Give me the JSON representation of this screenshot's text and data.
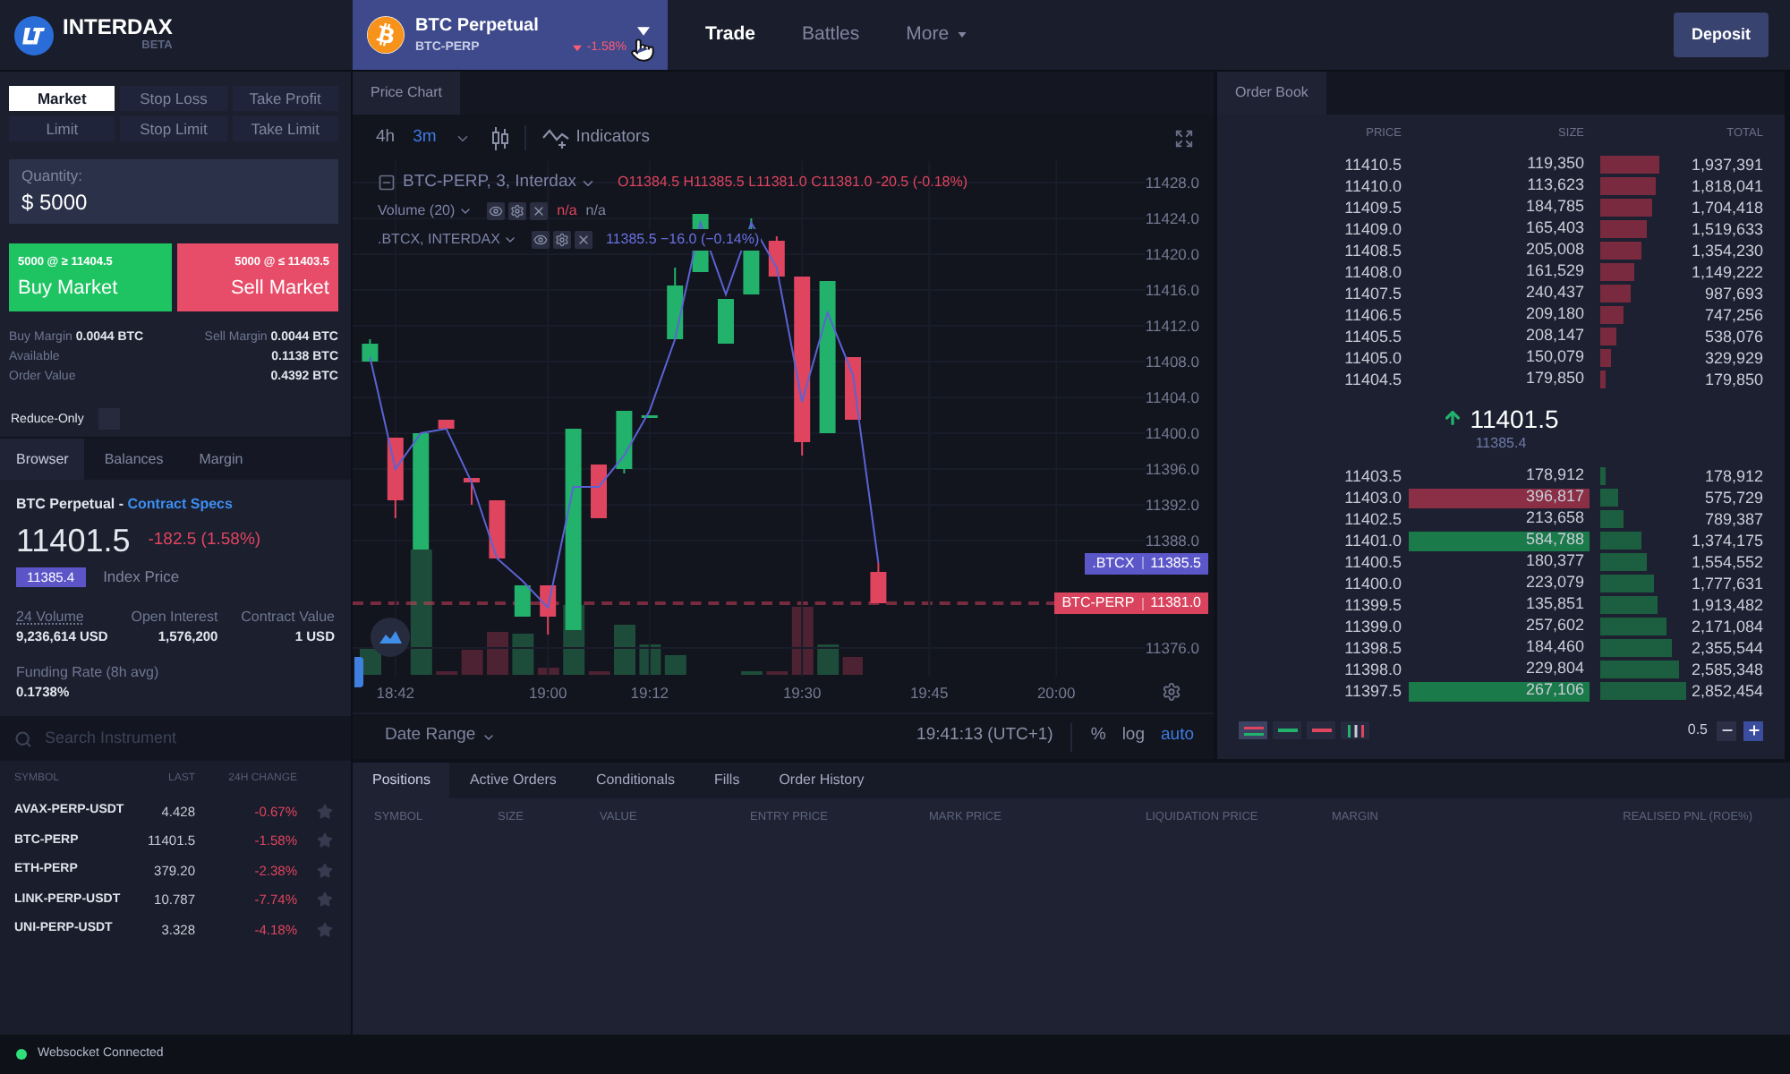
{
  "header": {
    "brand": "INTERDAX",
    "brand_tag": "BETA",
    "instrument": {
      "name": "BTC Perpetual",
      "symbol": "BTC-PERP",
      "change": "-1.58%"
    },
    "nav": [
      {
        "label": "Trade",
        "selected": true,
        "has_menu": false
      },
      {
        "label": "Battles",
        "selected": false,
        "has_menu": false
      },
      {
        "label": "More",
        "selected": false,
        "has_menu": true
      }
    ],
    "deposit_button": "Deposit"
  },
  "order_form": {
    "order_types": [
      {
        "label": "Market",
        "selected": true
      },
      {
        "label": "Stop Loss",
        "selected": false
      },
      {
        "label": "Take Profit",
        "selected": false
      },
      {
        "label": "Limit",
        "selected": false
      },
      {
        "label": "Stop Limit",
        "selected": false
      },
      {
        "label": "Take Limit",
        "selected": false
      }
    ],
    "quantity": {
      "label": "Quantity:",
      "value": "$ 5000"
    },
    "buy_button": {
      "detail": "5000 @ ≥ 11404.5",
      "label": "Buy Market"
    },
    "sell_button": {
      "detail": "5000 @ ≤ 11403.5",
      "label": "Sell Market"
    },
    "margins": [
      {
        "label": "Buy Margin",
        "value": "0.0044 BTC"
      },
      {
        "label": "Sell Margin",
        "value": "0.0044 BTC"
      }
    ],
    "balances": [
      {
        "label": "Available",
        "value": "0.1138 BTC"
      },
      {
        "label": "Order Value",
        "value": "0.4392 BTC"
      }
    ],
    "reduce_only": {
      "label": "Reduce-Only",
      "checked": false
    }
  },
  "info_panel": {
    "tabs": [
      {
        "label": "Browser",
        "selected": true
      },
      {
        "label": "Balances",
        "selected": false
      },
      {
        "label": "Margin",
        "selected": false
      }
    ],
    "title": "BTC Perpetual -",
    "link": "Contract Specs",
    "last_price": "11401.5",
    "change": "-182.5 (1.58%)",
    "index_price": "11385.4",
    "index_label": "Index Price",
    "stats": [
      {
        "label": "24 Volume",
        "value": "9,236,614 USD",
        "has_hint": true
      },
      {
        "label": "Open Interest",
        "value": "1,576,200",
        "has_hint": false
      },
      {
        "label": "Contract Value",
        "value": "1 USD",
        "has_hint": false
      }
    ],
    "funding": {
      "label": "Funding Rate (8h avg)",
      "value": "0.1738%"
    }
  },
  "instrument_list": {
    "search": {
      "placeholder": "Search Instrument"
    },
    "columns": [
      "SYMBOL",
      "LAST",
      "24H CHANGE"
    ],
    "rows": [
      {
        "symbol": "AVAX-PERP-USDT",
        "last": "4.428",
        "change": "-0.67%",
        "starred": false
      },
      {
        "symbol": "BTC-PERP",
        "last": "11401.5",
        "change": "-1.58%",
        "starred": false
      },
      {
        "symbol": "ETH-PERP",
        "last": "379.20",
        "change": "-2.38%",
        "starred": false
      },
      {
        "symbol": "LINK-PERP-USDT",
        "last": "10.787",
        "change": "-7.74%",
        "starred": false
      },
      {
        "symbol": "UNI-PERP-USDT",
        "last": "3.328",
        "change": "-4.18%",
        "starred": false
      }
    ]
  },
  "chart_panel": {
    "tab": "Price Chart",
    "intervals": [
      {
        "label": "4h",
        "selected": false
      },
      {
        "label": "3m",
        "selected": true
      }
    ],
    "indicators_button": "Indicators",
    "legend": {
      "title": "BTC-PERP, 3, Interdax",
      "ohlc": "O11384.5 H11385.5 L11381.0 C11381.0 -20.5 (-0.18%)",
      "volume": {
        "label": "Volume (20)",
        "values": [
          {
            "text": "n/a",
            "color": "#e0455f"
          },
          {
            "text": "n/a",
            "color": "#7f869f"
          }
        ]
      },
      "compare": {
        "label": ".BTCX, INTERDAX",
        "value": "11385.5 −16.0 (−0.14%)"
      }
    },
    "chart_data": {
      "type": "line",
      "categories": [
        null,
        "18:42",
        null,
        null,
        null,
        null,
        null,
        "19:00",
        null,
        null,
        null,
        "19:12",
        null,
        null,
        null,
        null,
        null,
        "19:30",
        null,
        null,
        null,
        null,
        "19:45",
        null,
        null,
        null,
        null,
        "20:00",
        null,
        null,
        null
      ],
      "series": [
        {
          "name": ".BTCX",
          "color": "#5b63d3",
          "values": [
            11408.5,
            11396,
            11400,
            11400.5,
            11394.5,
            11386,
            11383.5,
            11380.5,
            11394,
            11394,
            11397.5,
            11402.5,
            11410.5,
            11423.5,
            11415.5,
            11423.5,
            11418.5,
            11403.5,
            11413.5,
            11406.5,
            11385.5,
            null,
            null,
            null,
            null,
            null,
            null,
            null,
            null,
            null,
            null
          ]
        }
      ],
      "ylim": [
        11372.8,
        11430.4
      ],
      "yticks": [
        {
          "value": 11428,
          "label": "11428.0"
        },
        {
          "value": 11424,
          "label": "11424.0"
        },
        {
          "value": 11420,
          "label": "11420.0"
        },
        {
          "value": 11416,
          "label": "11416.0"
        },
        {
          "value": 11412,
          "label": "11412.0"
        },
        {
          "value": 11408,
          "label": "11408.0"
        },
        {
          "value": 11404,
          "label": "11404.0"
        },
        {
          "value": 11400,
          "label": "11400.0"
        },
        {
          "value": 11396,
          "label": "11396.0"
        },
        {
          "value": 11392,
          "label": "11392.0"
        },
        {
          "value": 11388,
          "label": "11388.0"
        },
        {
          "value": 11376,
          "label": "11376.0"
        }
      ],
      "grid": true
    },
    "price_tags": [
      {
        "value": "11385.5",
        "color": "#5b57c9",
        "line": false
      },
      {
        "symbol": "BTC-PERP",
        "value": "11381.0",
        "color": "#d9435e",
        "line": true
      }
    ],
    "footer": {
      "date_range": "Date Range",
      "time": "19:41:13 (UTC+1)",
      "scale_options": [
        {
          "label": "%",
          "selected": false
        },
        {
          "label": "log",
          "selected": false
        },
        {
          "label": "auto",
          "selected": true
        }
      ]
    }
  },
  "order_book": {
    "tab": "Order Book",
    "columns": [
      "PRICE",
      "SIZE",
      "TOTAL"
    ],
    "asks": [
      {
        "price": "11410.5",
        "size": "119,350",
        "total": "1,937,391"
      },
      {
        "price": "11410.0",
        "size": "113,623",
        "total": "1,818,041"
      },
      {
        "price": "11409.5",
        "size": "184,785",
        "total": "1,704,418"
      },
      {
        "price": "11409.0",
        "size": "165,403",
        "total": "1,519,633"
      },
      {
        "price": "11408.5",
        "size": "205,008",
        "total": "1,354,230"
      },
      {
        "price": "11408.0",
        "size": "161,529",
        "total": "1,149,222"
      },
      {
        "price": "11407.5",
        "size": "240,437",
        "total": "987,693"
      },
      {
        "price": "11406.5",
        "size": "209,180",
        "total": "747,256"
      },
      {
        "price": "11405.5",
        "size": "208,147",
        "total": "538,076"
      },
      {
        "price": "11405.0",
        "size": "150,079",
        "total": "329,929"
      },
      {
        "price": "11404.5",
        "size": "179,850",
        "total": "179,850"
      }
    ],
    "last_price": {
      "value": "11401.5",
      "rising": true
    },
    "index_price": "11385.4",
    "bids": [
      {
        "price": "11403.5",
        "size": "178,912",
        "total": "178,912",
        "flash": false
      },
      {
        "price": "11403.0",
        "size": "396,817",
        "total": "575,729",
        "flash": true,
        "color": "#8a2f45"
      },
      {
        "price": "11402.5",
        "size": "213,658",
        "total": "789,387",
        "flash": false
      },
      {
        "price": "11401.0",
        "size": "584,788",
        "total": "1,374,175",
        "flash": true,
        "color": "#1a7a4a"
      },
      {
        "price": "11400.5",
        "size": "180,377",
        "total": "1,554,552",
        "flash": false
      },
      {
        "price": "11400.0",
        "size": "223,079",
        "total": "1,777,631",
        "flash": false
      },
      {
        "price": "11399.5",
        "size": "135,851",
        "total": "1,913,482",
        "flash": false
      },
      {
        "price": "11399.0",
        "size": "257,602",
        "total": "2,171,084",
        "flash": false
      },
      {
        "price": "11398.5",
        "size": "184,460",
        "total": "2,355,544",
        "flash": false
      },
      {
        "price": "11398.0",
        "size": "229,804",
        "total": "2,585,348",
        "flash": false
      },
      {
        "price": "11397.5",
        "size": "267,106",
        "total": "2,852,454",
        "flash": true,
        "color": "#1a7a4a"
      }
    ],
    "views": [
      {
        "kind": "both",
        "selected": true
      },
      {
        "kind": "bids",
        "selected": false
      },
      {
        "kind": "asks",
        "selected": false
      },
      {
        "kind": "trades",
        "selected": false
      }
    ],
    "grouping": "0.5"
  },
  "positions_panel": {
    "tabs": [
      {
        "label": "Positions",
        "selected": true
      },
      {
        "label": "Active Orders",
        "selected": false
      },
      {
        "label": "Conditionals",
        "selected": false
      },
      {
        "label": "Fills",
        "selected": false
      },
      {
        "label": "Order History",
        "selected": false
      }
    ],
    "columns": [
      "SYMBOL",
      "SIZE",
      "VALUE",
      "ENTRY PRICE",
      "MARK PRICE",
      "LIQUIDATION PRICE",
      "MARGIN",
      "REALISED PNL (ROE%)"
    ]
  },
  "status_bar": {
    "text": "Websocket Connected",
    "connected": true
  }
}
